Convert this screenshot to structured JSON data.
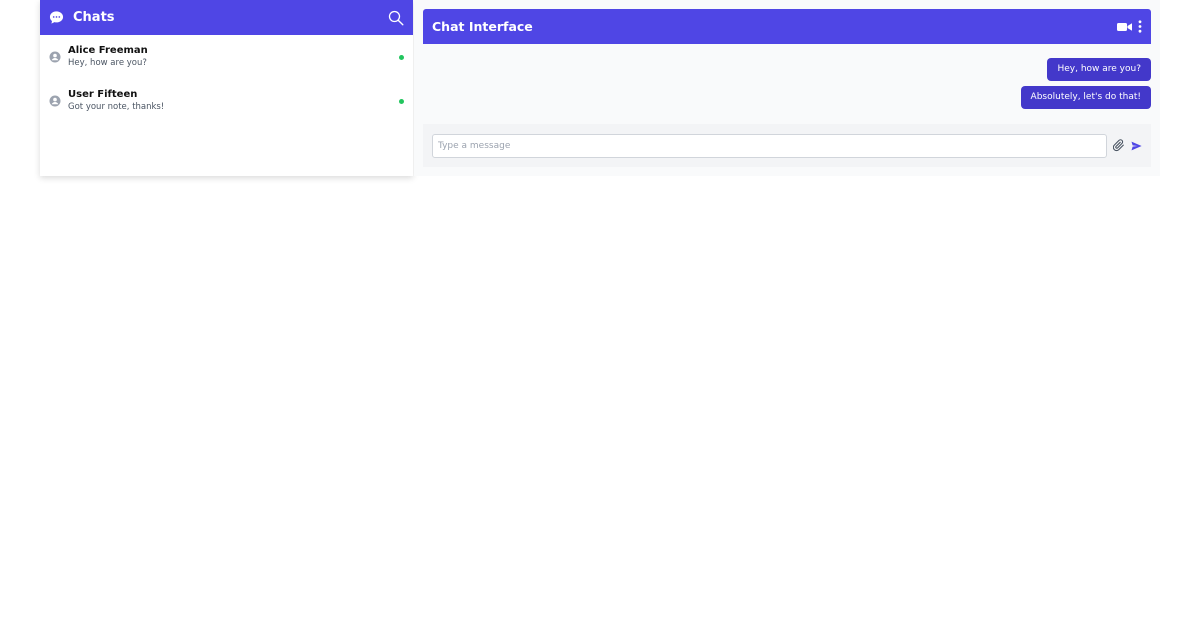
{
  "sidebar": {
    "title": "Chats",
    "header_icon": "chat-bubble-icon",
    "search_icon": "search-icon",
    "contacts": [
      {
        "name": "Alice Freeman",
        "preview": "Hey, how are you?",
        "status": "online"
      },
      {
        "name": "User Fifteen",
        "preview": "Got your note, thanks!",
        "status": "online"
      }
    ]
  },
  "chat": {
    "title": "Chat Interface",
    "header_icons": [
      "video-camera-icon",
      "more-vertical-icon"
    ],
    "messages": [
      {
        "text": "Hey, how are you?",
        "direction": "outgoing"
      },
      {
        "text": "Absolutely, let's do that!",
        "direction": "outgoing"
      }
    ],
    "composer": {
      "placeholder": "Type a message",
      "value": "",
      "attach_icon": "paperclip-icon",
      "send_icon": "send-icon"
    }
  },
  "colors": {
    "brand": "#4f46e5",
    "bubble": "#4338ca",
    "online": "#22c55e",
    "chat_bg": "#f9fafb",
    "composer_bg": "#f3f4f6"
  }
}
